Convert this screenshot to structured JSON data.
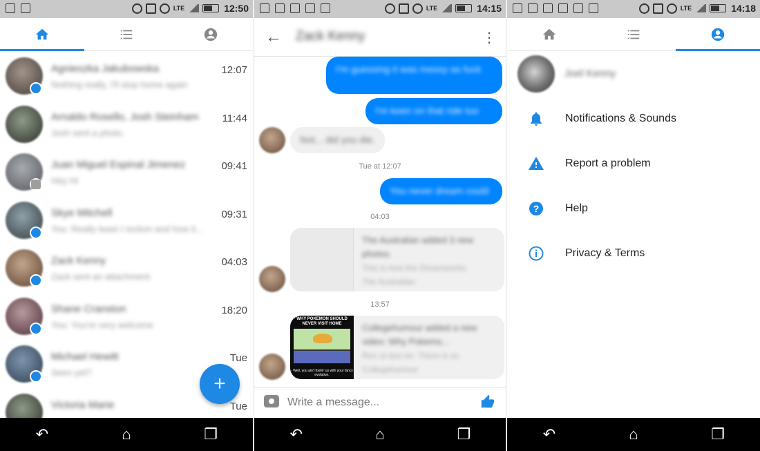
{
  "colors": {
    "accent": "#1e88e5",
    "messenger_blue": "#0084ff",
    "bubble_gray": "#f1f0f0",
    "status_bar": "#c9c9c9",
    "nav_bar": "#000000"
  },
  "screens": [
    {
      "status_time": "12:50",
      "tabs": [
        {
          "icon": "home-icon",
          "active": true
        },
        {
          "icon": "list-icon",
          "active": false
        },
        {
          "icon": "profile-icon",
          "active": false
        }
      ],
      "conversations": [
        {
          "name": "Agnieszka Jakubowska",
          "snippet": "Nothing really, I'll stop home again",
          "time": "12:07",
          "badge": "messenger"
        },
        {
          "name": "Arnaldo Rosello, Josh Steinham",
          "snippet": "Josh sent a photo.",
          "time": "11:44",
          "badge": "none"
        },
        {
          "name": "Juan Miguel Espinal Jimenez",
          "snippet": "Hey Hi",
          "time": "09:41",
          "badge": "facebook"
        },
        {
          "name": "Skye Mitchell",
          "snippet": "You: Really least I reckon and how it...",
          "time": "09:31",
          "badge": "messenger"
        },
        {
          "name": "Zack Kenny",
          "snippet": "Zack sent an attachment.",
          "time": "04:03",
          "badge": "messenger"
        },
        {
          "name": "Shane Cranston",
          "snippet": "You: You're very welcome",
          "time": "18:20",
          "badge": "messenger"
        },
        {
          "name": "Michael Hewitt",
          "snippet": "Seen yet?",
          "time": "Tue",
          "badge": "messenger"
        },
        {
          "name": "Victoria Marie",
          "snippet": "",
          "time": "Tue",
          "badge": "none"
        }
      ],
      "fab_label": "+"
    },
    {
      "status_time": "14:15",
      "chat_title": "Zack Kenny",
      "messages": [
        {
          "text": "I'm guessing it was messy as fuck",
          "direction": "out"
        },
        {
          "text": "I'm keen on that ride too",
          "direction": "out"
        },
        {
          "text": "Not... did you die.",
          "direction": "in"
        }
      ],
      "timestamps": [
        "Tue at 12:07",
        "04:03",
        "13:57"
      ],
      "later_message": "You never dream could",
      "link_cards": [
        {
          "title": "The Australian added 3 new photos.",
          "sub1": "This is how the Dreamworks",
          "sub2": "The Australian"
        },
        {
          "title": "Collegehumour added a new video: Why Pokemo...",
          "sub1": "Rev ut doo ler: There is so",
          "sub2": "Collegehumour"
        }
      ],
      "meme": {
        "title": "WHY POKEMON SHOULD NEVER VISIT HOME",
        "caption": "- Well, you ain't foolin' us with your fancy evolution."
      },
      "composer_placeholder": "Write a message..."
    },
    {
      "status_time": "14:18",
      "profile_name": "Joel Kenny",
      "menu": [
        {
          "icon": "bell-icon",
          "label": "Notifications & Sounds"
        },
        {
          "icon": "warning-icon",
          "label": "Report a problem"
        },
        {
          "icon": "help-icon",
          "label": "Help"
        },
        {
          "icon": "info-icon",
          "label": "Privacy & Terms"
        }
      ]
    }
  ],
  "navbar": [
    "back-icon",
    "home-icon",
    "recents-icon"
  ]
}
